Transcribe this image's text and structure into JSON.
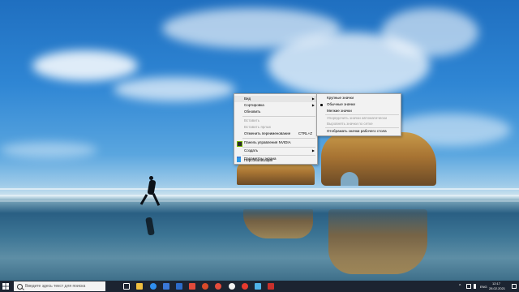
{
  "desktop": {
    "wallpaper": "beach-runner-sea-stacks"
  },
  "context_menu": {
    "items": [
      {
        "label": "Вид",
        "has_submenu": true
      },
      {
        "label": "Сортировка",
        "has_submenu": true
      },
      {
        "label": "Обновить"
      },
      {
        "label": "Вставить",
        "disabled": true
      },
      {
        "label": "Вставить ярлык",
        "disabled": true
      },
      {
        "label": "Отменить переименование",
        "shortcut": "CTRL+Z"
      },
      {
        "label": "Панель управления NVIDIA",
        "icon": "nvidia-icon"
      },
      {
        "label": "Создать",
        "has_submenu": true
      },
      {
        "label": "Параметры экрана",
        "icon": "display-settings-icon"
      },
      {
        "label": "Персонализация",
        "icon": "personalize-icon"
      }
    ]
  },
  "view_submenu": {
    "items": [
      {
        "label": "Крупные значки"
      },
      {
        "label": "Обычные значки",
        "selected": true
      },
      {
        "label": "Мелкие значки"
      },
      {
        "label": "Упорядочить значки автоматически",
        "disabled": true
      },
      {
        "label": "Выровнять значки по сетке",
        "disabled": true
      },
      {
        "label": "Отображать значки рабочего стола"
      }
    ]
  },
  "taskbar": {
    "search_placeholder": "Введите здесь текст для поиска",
    "language": "ENG",
    "time": "12:17",
    "date": "28.02.2021",
    "pinned_icons": [
      "task-view-icon",
      "file-explorer-icon",
      "edge-icon",
      "store-icon",
      "mail-icon",
      "calculator-icon",
      "app-icon",
      "media-icon",
      "browser-icon",
      "opera-icon",
      "chrome-icon",
      "yandex-icon",
      "paint-icon",
      "app-red-icon"
    ]
  }
}
